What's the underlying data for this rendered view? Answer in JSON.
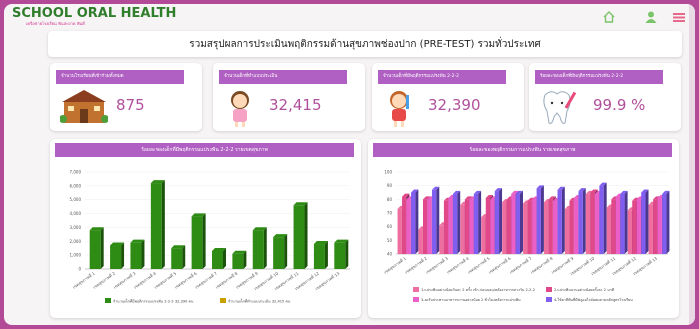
{
  "header": {
    "logo_main": "SCHOOL ORAL HEALTH",
    "logo_sub": "เครือข่ายโรงเรียน ฟันสะอาด ฟันดี",
    "page_title": "รวมสรุปผลการประเมินพฤติกรรมด้านสุขภาพช่องปาก (PRE-TEST) รวมทั่วประเทศ"
  },
  "nav": {
    "icons": [
      "home-icon",
      "user-icon",
      "menu-icon"
    ]
  },
  "cards": [
    {
      "label": "จำนวนโรงเรียนที่เข้าร่วมทั้งหมด",
      "value": "875",
      "icon": "school-icon"
    },
    {
      "label": "จำนวนเด็กที่ทำแบบประเมิน",
      "value": "32,415",
      "icon": "girl-icon"
    },
    {
      "label": "จำนวนเด็กที่มีพฤติกรรมแปรงฟัน 2-2-2",
      "value": "32,390",
      "icon": "kid-icon"
    },
    {
      "label": "ร้อยละของเด็กที่มีพฤติกรรมแปรงฟัน 2-2-2",
      "value": "99.9 %",
      "icon": "tooth-icon"
    }
  ],
  "colors": {
    "accent": "#b05fc2",
    "value_text": "#b0509c",
    "bar_green": "#2e8b14",
    "bar_gold": "#c9a000",
    "bar_pink_light": "#ee6f9f",
    "bar_pink": "#e0488a",
    "bar_magenta": "#ea5fc8",
    "bar_purple": "#7f5ef0"
  },
  "chart_left_title": "ร้อยละของเด็กที่มีพฤติกรรมแปรงฟัน 2-2-2 รายเขตสุขภาพ",
  "chart_right_title": "ร้อยละของพฤติกรรมการแปรงฟัน รายเขตสุขภาพ",
  "chart_data": [
    {
      "type": "bar",
      "categories": [
        "เขตสุขภาพที่ 1",
        "เขตสุขภาพที่ 2",
        "เขตสุขภาพที่ 3",
        "เขตสุขภาพที่ 4",
        "เขตสุขภาพที่ 5",
        "เขตสุขภาพที่ 6",
        "เขตสุขภาพที่ 7",
        "เขตสุขภาพที่ 8",
        "เขตสุขภาพที่ 9",
        "เขตสุขภาพที่ 10",
        "เขตสุขภาพที่ 11",
        "เขตสุขภาพที่ 12",
        "เขตสุขภาพที่ 13"
      ],
      "yticks": [
        "0",
        "1,000",
        "2,000",
        "3,000",
        "4,000",
        "5,000",
        "6,000",
        "7,000"
      ],
      "ylim": [
        0,
        7000
      ],
      "series": [
        {
          "name": "จำนวนเด็กที่มีพฤติกรรมแปรงฟัน 2-2-2 32,390 คน",
          "values": [
            2800,
            1700,
            1900,
            6200,
            1500,
            3800,
            1300,
            1100,
            2800,
            2300,
            4600,
            1800,
            1900
          ]
        },
        {
          "name": "จำนวนเด็กที่ทำแบบประเมิน 32,415 คน",
          "values": [
            2800,
            1700,
            1900,
            6200,
            1500,
            3800,
            1300,
            1100,
            2800,
            2300,
            4600,
            1800,
            1900
          ]
        }
      ],
      "legend": "bottom"
    },
    {
      "type": "bar",
      "categories": [
        "เขตสุขภาพที่ 1",
        "เขตสุขภาพที่ 2",
        "เขตสุขภาพที่ 3",
        "เขตสุขภาพที่ 4",
        "เขตสุขภาพที่ 5",
        "เขตสุขภาพที่ 6",
        "เขตสุขภาพที่ 7",
        "เขตสุขภาพที่ 8",
        "เขตสุขภาพที่ 9",
        "เขตสุขภาพที่ 10",
        "เขตสุขภาพที่ 11",
        "เขตสุขภาพที่ 12",
        "เขตสุขภาพที่ 13"
      ],
      "yticks": [
        "40",
        "50",
        "60",
        "70",
        "80",
        "90",
        "100"
      ],
      "ylim": [
        40,
        100
      ],
      "series": [
        {
          "name": "1.แปรงฟันอย่างน้อยวันละ 2 ครั้ง เช้า-ก่อนนอน/หลังอาหารกลางวัน 2-2-2",
          "values": [
            73,
            58,
            61,
            76,
            67,
            78,
            77,
            78,
            73,
            84,
            74,
            72,
            76
          ]
        },
        {
          "name": "2.แปรงฟันนานอย่างน้อยครั้งละ 2 นาที",
          "values": [
            82,
            80,
            79,
            80,
            81,
            80,
            79,
            80,
            79,
            85,
            80,
            79,
            80
          ]
        },
        {
          "name": "3.งดรับประทานอาหารหวานอย่างน้อย 2 ชั่วโมงหลังการแปรงฟัน",
          "values": [
            80,
            80,
            81,
            80,
            80,
            84,
            80,
            79,
            81,
            84,
            82,
            80,
            81
          ]
        },
        {
          "name": "4.ใช้ยาสีฟันที่มีฟลูออไรด์ผสมตามหลักสูตรโรงเรียน",
          "values": [
            85,
            87,
            84,
            84,
            86,
            84,
            88,
            87,
            86,
            90,
            84,
            85,
            84
          ]
        }
      ],
      "legend": "bottom"
    }
  ]
}
